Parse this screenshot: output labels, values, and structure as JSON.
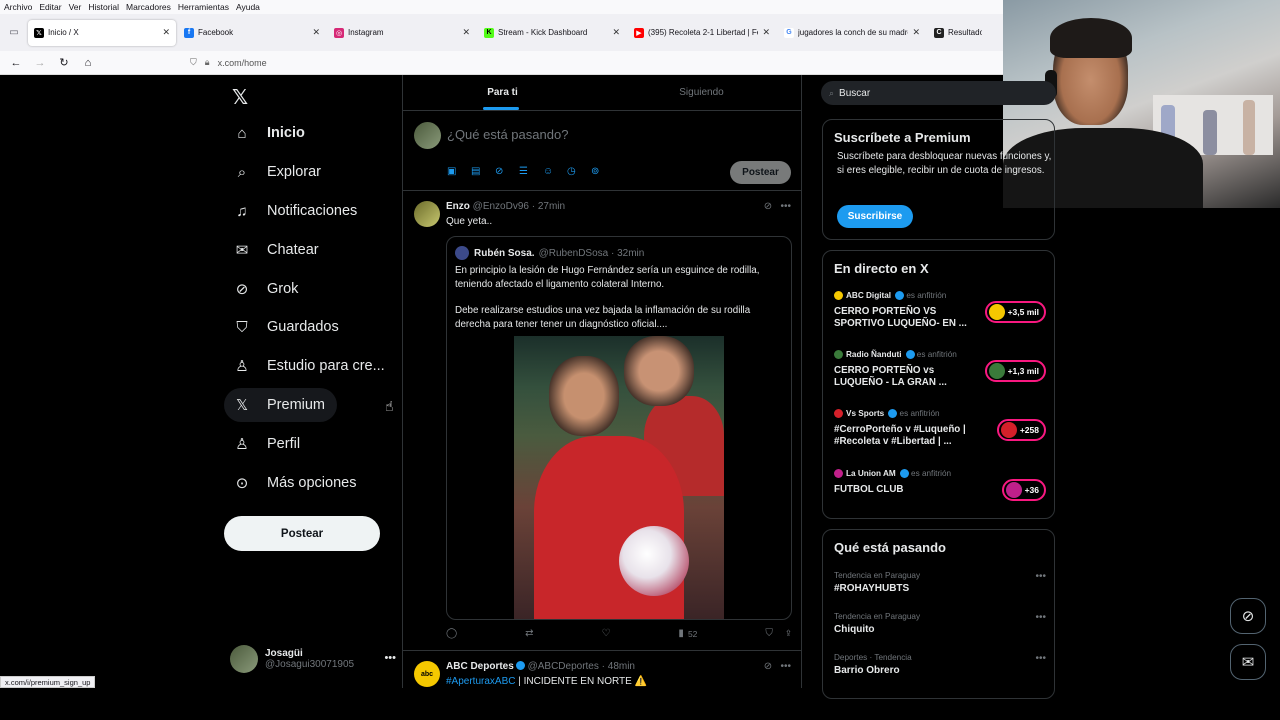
{
  "browser": {
    "menu": [
      "Archivo",
      "Editar",
      "Ver",
      "Historial",
      "Marcadores",
      "Herramientas",
      "Ayuda"
    ],
    "tabs": [
      {
        "label": "Inicio / X",
        "icon": "x-logo-icon",
        "color": "#000000"
      },
      {
        "label": "Facebook",
        "icon": "facebook-icon",
        "color": "#1877f2"
      },
      {
        "label": "Instagram",
        "icon": "instagram-icon",
        "color": "#d62976"
      },
      {
        "label": "Stream - Kick Dashboard",
        "icon": "kick-icon",
        "color": "#53fc18"
      },
      {
        "label": "(395) Recoleta 2-1 Libertad | Fe",
        "icon": "youtube-icon",
        "color": "#ff0000"
      },
      {
        "label": "jugadores la conch de su madre",
        "icon": "google-icon",
        "color": "#4285f4"
      },
      {
        "label": "Resultados de",
        "icon": "c-icon",
        "color": "#222222"
      }
    ],
    "url": "x.com/home",
    "status_url": "x.com/i/premium_sign_up"
  },
  "nav": {
    "items": [
      {
        "label": "Inicio",
        "icon": "home-icon"
      },
      {
        "label": "Explorar",
        "icon": "search-icon"
      },
      {
        "label": "Notificaciones",
        "icon": "bell-icon"
      },
      {
        "label": "Chatear",
        "icon": "mail-icon"
      },
      {
        "label": "Grok",
        "icon": "grok-icon"
      },
      {
        "label": "Guardados",
        "icon": "bookmark-icon"
      },
      {
        "label": "Estudio para cre...",
        "icon": "creator-studio-icon"
      },
      {
        "label": "Premium",
        "icon": "x-logo-icon"
      },
      {
        "label": "Perfil",
        "icon": "person-icon"
      },
      {
        "label": "Más opciones",
        "icon": "more-circle-icon"
      }
    ],
    "post_label": "Postear",
    "account": {
      "name": "Josagüi",
      "handle": "@Josagui30071905"
    }
  },
  "feed": {
    "tabs": [
      "Para ti",
      "Siguiendo"
    ],
    "composer_placeholder": "¿Qué está pasando?",
    "composer_post": "Postear",
    "tweet1": {
      "name": "Enzo",
      "meta": "@EnzoDv96 · 27min",
      "text": "Que yeta..",
      "quote": {
        "name": "Rubén Sosa.",
        "meta": "@RubenDSosa · 32min",
        "p1": "En principio la lesión de Hugo Fernández sería  un esguince de rodilla, teniendo afectado el ligamento colateral Interno.",
        "p2": "Debe realizarse estudios una vez bajada la inflamación de su rodilla derecha para tener tener un diagnóstico oficial...."
      },
      "views": "52"
    },
    "tweet2": {
      "name": "ABC Deportes",
      "meta": "@ABCDeportes · 48min",
      "hashtag": "#AperturaxABC",
      "text": " | INCIDENTE EN NORTE ⚠️",
      "avatar_text": "abc"
    }
  },
  "sidebar": {
    "search_placeholder": "Buscar",
    "premium": {
      "title": "Suscríbete a Premium",
      "text": "Suscríbete para desbloquear nuevas funciones y, si eres elegible, recibir un de cuota de ingresos.",
      "button": "Suscribirse"
    },
    "live": {
      "title": "En directo en X",
      "items": [
        {
          "host": "ABC Digital",
          "role": "es anfitrión",
          "title": "CERRO PORTEÑO VS SPORTIVO LUQUEÑO- EN ...",
          "count": "+3,5 mil",
          "color": "#f5c800"
        },
        {
          "host": "Radio Ñanduti",
          "role": "es anfitrión",
          "title": "CERRO PORTEÑO vs LUQUEÑO - LA GRAN ...",
          "count": "+1,3 mil",
          "color": "#3a7a3a"
        },
        {
          "host": "Vs Sports",
          "role": "es anfitrión",
          "title": "#CerroPorteño v #Luqueño | #Recoleta v #Libertad | ...",
          "count": "+258",
          "color": "#d4202a"
        },
        {
          "host": "La Union AM",
          "role": "es anfitrión",
          "title": "FUTBOL CLUB",
          "count": "+36",
          "color": "#c0208a"
        }
      ]
    },
    "trends": {
      "title": "Qué está pasando",
      "items": [
        {
          "category": "Tendencia en Paraguay",
          "name": "#ROHAYHUBTS"
        },
        {
          "category": "Tendencia en Paraguay",
          "name": "Chiquito"
        },
        {
          "category": "Deportes · Tendencia",
          "name": "Barrio Obrero"
        }
      ]
    }
  }
}
